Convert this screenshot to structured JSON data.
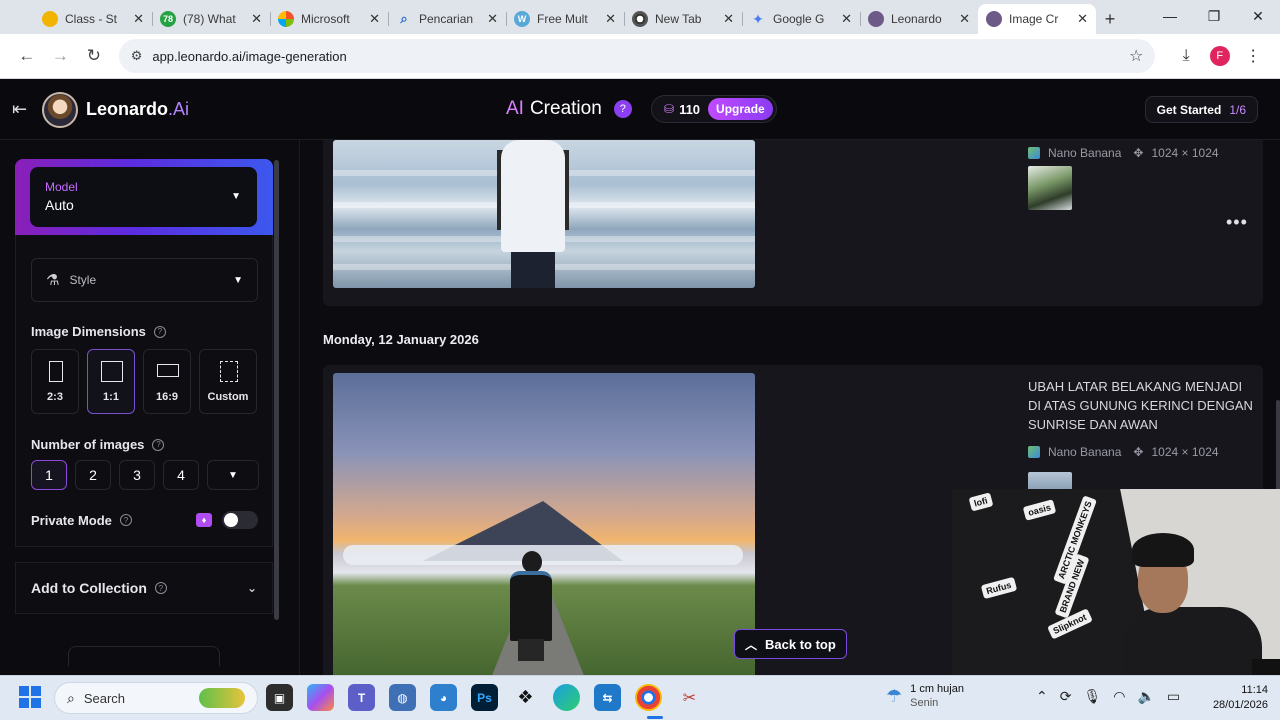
{
  "browser": {
    "tabs": [
      {
        "label": "Class - St",
        "fav_color": "#f1b400"
      },
      {
        "label": "(78) What",
        "fav_color": "#25a244",
        "fav_text": "78"
      },
      {
        "label": "Microsoft",
        "fav_color": "#7b61ff"
      },
      {
        "label": "Pencarian",
        "fav_color": "#2a6fd1"
      },
      {
        "label": "Free Mult",
        "fav_color": "#58a8d8"
      },
      {
        "label": "New Tab",
        "fav_color": "#333333"
      },
      {
        "label": "Google G",
        "fav_color": "#4a7bf0"
      },
      {
        "label": "Leonardo",
        "fav_color": "#6d5a88"
      },
      {
        "label": "Image Cr",
        "fav_color": "#6d5a88"
      }
    ],
    "active_tab_index": 8,
    "new_tab_symbol": "+",
    "url": "app.leonardo.ai/image-generation",
    "profile_initial": "F"
  },
  "header": {
    "brand": "Leonardo",
    "brand_suffix": ".Ai",
    "title_prefix": "AI",
    "title": "Creation",
    "help": "?",
    "token_count": "110",
    "upgrade_label": "Upgrade",
    "get_started_label": "Get Started",
    "get_started_progress": "1/6"
  },
  "sidebar": {
    "model_label": "Model",
    "model_value": "Auto",
    "style_placeholder": "Style",
    "image_dimensions_label": "Image Dimensions",
    "dimensions": [
      {
        "label": "2:3",
        "selected": false
      },
      {
        "label": "1:1",
        "selected": true
      },
      {
        "label": "16:9",
        "selected": false
      },
      {
        "label": "Custom",
        "selected": false
      }
    ],
    "number_of_images_label": "Number of images",
    "number_options": [
      "1",
      "2",
      "3",
      "4"
    ],
    "selected_number": "1",
    "private_mode_label": "Private Mode",
    "private_mode_on": false,
    "add_to_collection_label": "Add to Collection"
  },
  "main": {
    "generation_1": {
      "model": "Nano Banana",
      "dimensions": "1024 × 1024"
    },
    "date_heading": "Monday, 12 January 2026",
    "generation_2": {
      "prompt": "UBAH LATAR BELAKANG MENJADI DI ATAS GUNUNG KERINCI DENGAN SUNRISE DAN AWAN",
      "model": "Nano Banana",
      "dimensions": "1024 × 1024"
    },
    "back_to_top_label": "Back to top"
  },
  "webcam": {
    "stickers": [
      "lofi",
      "oasis",
      "ARCTIC MONKEYS",
      "Rufus",
      "BRAND NEW",
      "Slipknot"
    ]
  },
  "taskbar": {
    "search_placeholder": "Search",
    "weather_line1": "1 cm hujan",
    "weather_line2": "Senin",
    "time": "11:14",
    "date": "28/01/2026"
  },
  "colors": {
    "accent_purple": "#8b3ff0",
    "upgrade_gradient_start": "#c04bff",
    "app_background": "#0b0b10",
    "card_background": "#16161c"
  }
}
